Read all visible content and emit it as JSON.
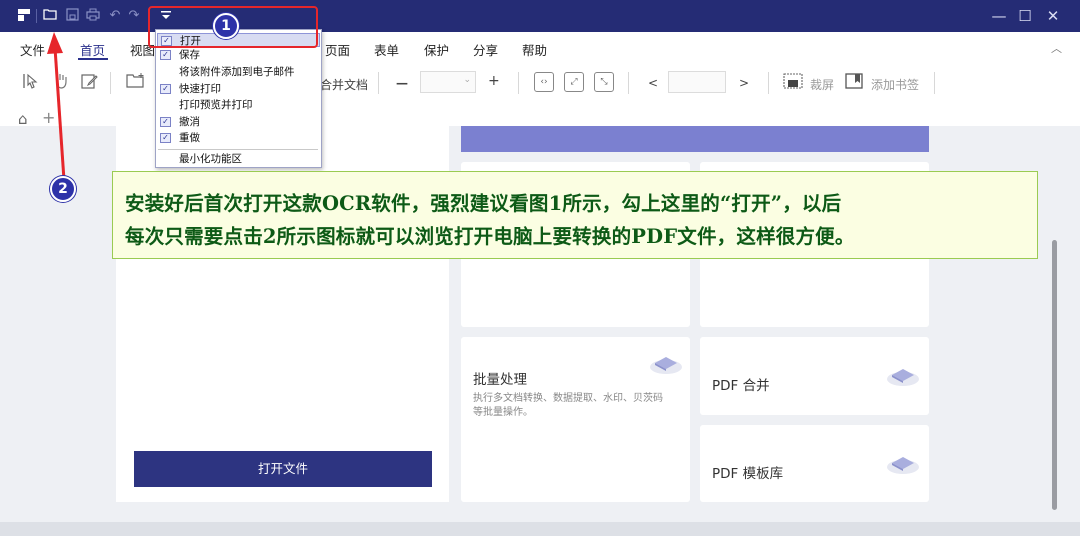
{
  "quick_access": {
    "icons": [
      "app-logo-icon",
      "new-file-icon",
      "save-icon",
      "print-icon",
      "undo-icon",
      "redo-icon",
      "dropdown-arrow-icon"
    ],
    "dropdown_symbol": "▾"
  },
  "window_controls": {
    "minimize": "—",
    "maximize": "☐",
    "close": "✕"
  },
  "menu": {
    "items": [
      "文件",
      "首页",
      "视图",
      "页面",
      "表单",
      "保护",
      "分享",
      "帮助"
    ],
    "active": "首页"
  },
  "toolbar": {
    "merge_label": "合并文档",
    "minus": "—",
    "plus": "+",
    "prev": "<",
    "next": ">",
    "crop_label": "裁屏",
    "bookmark_label": "添加书签"
  },
  "tabs": {
    "home_symbol": "⌂",
    "add_symbol": "+"
  },
  "quick_menu": {
    "items": [
      {
        "label": "打开",
        "checked": true,
        "highlighted": true
      },
      {
        "label": "保存",
        "checked": true,
        "highlighted": false
      },
      {
        "label": "将该附件添加到电子邮件",
        "checked": false,
        "highlighted": false
      },
      {
        "label": "快速打印",
        "checked": true,
        "highlighted": false
      },
      {
        "label": "打印预览并打印",
        "checked": false,
        "highlighted": false
      },
      {
        "label": "撤消",
        "checked": true,
        "highlighted": false
      },
      {
        "label": "重做",
        "checked": true,
        "highlighted": false
      },
      {
        "label": "最小化功能区",
        "checked": false,
        "highlighted": false
      }
    ]
  },
  "main": {
    "open_button": "打开文件",
    "cards": {
      "batch": {
        "title": "批量处理",
        "desc_line1": "执行多文档转换、数据提取、水印、贝茨码",
        "desc_line2": "等批量操作。"
      },
      "merge": {
        "title": "PDF 合并"
      },
      "template": {
        "title": "PDF 模板库"
      }
    }
  },
  "annotations": {
    "badge1": "1",
    "badge2": "2",
    "banner_line1": "安装好后首次打开这款OCR软件，强烈建议看图1所示，勾上这里的“打开”，以后",
    "banner_line2": "每次只需要点击2所示图标就可以浏览打开电脑上要转换的PDF文件，这样很方便。",
    "arrow_color": "#e6262b",
    "badge_color": "#2d32a8",
    "banner_text_color": "#0d5a16"
  },
  "colors": {
    "titlebar": "#252c75",
    "accent": "#2d3481",
    "card_accent": "#7b80d0"
  }
}
